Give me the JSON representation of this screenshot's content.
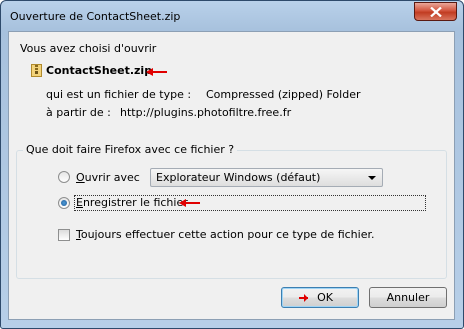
{
  "window": {
    "title": "Ouverture de ContactSheet.zip"
  },
  "dialog": {
    "intro": "Vous avez choisi d'ouvrir",
    "file_name": "ContactSheet.zip",
    "type_label": "qui est un fichier de type :",
    "type_value": "Compressed (zipped) Folder",
    "source_label": "à partir de :",
    "source_value": "http://plugins.photofiltre.free.fr",
    "question": "Que doit faire Firefox avec ce fichier ?",
    "open_with_label": "Ouvrir avec",
    "open_with_selected": "Explorateur Windows (défaut)",
    "save_label": "Enregistrer le fichier",
    "always_label": "Toujours effectuer cette action pour ce type de fichier.",
    "ok_label": "OK",
    "cancel_label": "Annuler"
  },
  "state": {
    "selected_action": "save",
    "always_checked": false
  },
  "colors": {
    "annotation_arrow": "#e00000",
    "title_bar": "#b9d1ea",
    "client_bg": "#f0f0f0",
    "close_button": "#c13c22"
  },
  "icons": {
    "file": "zip-file-icon",
    "close": "close-x-icon",
    "annotation": "red-arrow-icon"
  }
}
